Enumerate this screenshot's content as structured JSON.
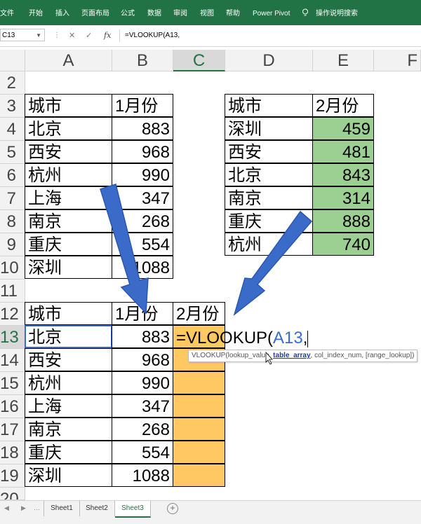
{
  "ribbon": {
    "tabs": [
      "文件",
      "开始",
      "插入",
      "页面布局",
      "公式",
      "数据",
      "审阅",
      "视图",
      "帮助",
      "Power Pivot"
    ],
    "tell_me": "操作说明搜索"
  },
  "formula_bar": {
    "name_box": "C13",
    "formula": "=VLOOKUP(A13,"
  },
  "columns": [
    "A",
    "B",
    "C",
    "D",
    "E",
    "F"
  ],
  "rows": [
    "2",
    "3",
    "4",
    "5",
    "6",
    "7",
    "8",
    "9",
    "10",
    "11",
    "12",
    "13",
    "14",
    "15",
    "16",
    "17",
    "18",
    "19",
    "20"
  ],
  "table1": {
    "header": [
      "城市",
      "1月份"
    ],
    "cities": [
      "北京",
      "西安",
      "杭州",
      "上海",
      "南京",
      "重庆",
      "深圳"
    ],
    "values": [
      "883",
      "968",
      "990",
      "347",
      "268",
      "554",
      "1088"
    ]
  },
  "table2": {
    "header": [
      "城市",
      "2月份"
    ],
    "cities": [
      "深圳",
      "西安",
      "北京",
      "南京",
      "重庆",
      "杭州"
    ],
    "values": [
      "459",
      "481",
      "843",
      "314",
      "888",
      "740"
    ]
  },
  "table3": {
    "header": [
      "城市",
      "1月份",
      "2月份"
    ],
    "cities": [
      "北京",
      "西安",
      "杭州",
      "上海",
      "南京",
      "重庆",
      "深圳"
    ],
    "values": [
      "883",
      "968",
      "990",
      "347",
      "268",
      "554",
      "1088"
    ]
  },
  "edit": {
    "prefix": "=VLOOKUP(",
    "ref": "A13",
    "suffix": ","
  },
  "tooltip": {
    "fn": "VLOOKUP(lookup_value, ",
    "current": "table_array",
    "rest": ", col_index_num, [range_lookup])"
  },
  "sheets": [
    "Sheet1",
    "Sheet2",
    "Sheet3"
  ],
  "active_sheet": "Sheet3",
  "colors": {
    "accent": "#217346",
    "green_fill": "#9ccf92",
    "orange_fill": "#ffc862",
    "arrow": "#3a6bc9"
  }
}
